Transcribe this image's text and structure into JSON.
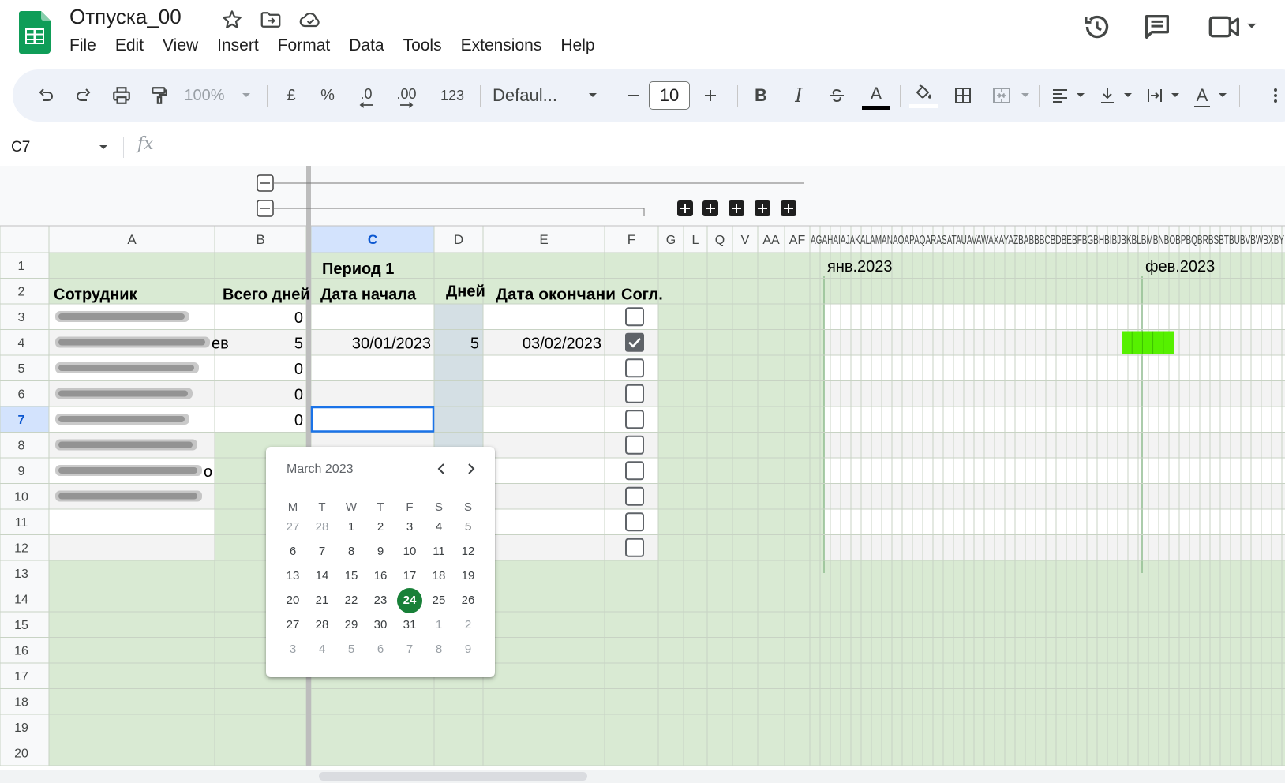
{
  "document": {
    "title": "Отпуска_00"
  },
  "menu": [
    "File",
    "Edit",
    "View",
    "Insert",
    "Format",
    "Data",
    "Tools",
    "Extensions",
    "Help"
  ],
  "toolbar": {
    "zoom": "100%",
    "currency": "£",
    "percent": "%",
    "dec_decrease": ".0",
    "dec_increase": ".00",
    "number_format": "123",
    "font": "Defaul...",
    "font_size": "10",
    "bold": "B",
    "italic": "I",
    "text_color_glyph": "A",
    "text_rotation_glyph": "A"
  },
  "formula_bar": {
    "cell_ref": "C7",
    "fx": "fx",
    "value": ""
  },
  "columns": {
    "main": [
      {
        "id": "A"
      },
      {
        "id": "B"
      },
      {
        "id": "C"
      },
      {
        "id": "D"
      },
      {
        "id": "E"
      },
      {
        "id": "F"
      }
    ],
    "narrow": [
      "G",
      "L",
      "Q",
      "V",
      "AA",
      "AF"
    ],
    "dense_header_text": "AGAHAIAJAKALAMANAOAPAQARASATAUAVAWAXAYAZBABBBCBDBEBFBGBHBIBJBKBLBMBNBOBPBQBRBSBTBUBVBWBXBY"
  },
  "month_labels": [
    "янв.2023",
    "фев.2023"
  ],
  "header_row1": {
    "period": "Период 1"
  },
  "header_row2": {
    "employee": "Сотрудник",
    "total_days": "Всего дней",
    "start_date": "Дата начала",
    "days": "Дней",
    "end_date": "Дата окончани",
    "approved": "Согл."
  },
  "rows": [
    {
      "num": "1"
    },
    {
      "num": "2"
    },
    {
      "num": "3",
      "total": "0",
      "start": "",
      "days": "",
      "end": "",
      "approved": false
    },
    {
      "num": "4",
      "name_suffix": "ев",
      "total": "5",
      "start": "30/01/2023",
      "days": "5",
      "end": "03/02/2023",
      "approved": true
    },
    {
      "num": "5",
      "total": "0",
      "approved": false
    },
    {
      "num": "6",
      "total": "0",
      "approved": false
    },
    {
      "num": "7",
      "total": "0",
      "approved": false
    },
    {
      "num": "8",
      "approved": false
    },
    {
      "num": "9",
      "name_suffix": "о",
      "approved": false
    },
    {
      "num": "10",
      "approved": false
    },
    {
      "num": "11",
      "approved": false
    },
    {
      "num": "12",
      "approved": false
    },
    {
      "num": "13"
    },
    {
      "num": "14"
    },
    {
      "num": "15"
    },
    {
      "num": "16"
    },
    {
      "num": "17"
    },
    {
      "num": "18"
    },
    {
      "num": "19"
    },
    {
      "num": "20"
    }
  ],
  "datepicker": {
    "month": "March 2023",
    "weekdays": [
      "M",
      "T",
      "W",
      "T",
      "F",
      "S",
      "S"
    ],
    "weeks": [
      [
        "27",
        "28",
        "1",
        "2",
        "3",
        "4",
        "5"
      ],
      [
        "6",
        "7",
        "8",
        "9",
        "10",
        "11",
        "12"
      ],
      [
        "13",
        "14",
        "15",
        "16",
        "17",
        "18",
        "19"
      ],
      [
        "20",
        "21",
        "22",
        "23",
        "24",
        "25",
        "26"
      ],
      [
        "27",
        "28",
        "29",
        "30",
        "31",
        "1",
        "2"
      ],
      [
        "3",
        "4",
        "5",
        "6",
        "7",
        "8",
        "9"
      ]
    ],
    "selected": "24"
  },
  "colors": {
    "sheet_green": "#d9ead3",
    "header_gray": "#f8f9fa",
    "selection_blue": "#1a73e8",
    "bar_green": "#56f000",
    "days_col_blue": "#d4dfe4"
  }
}
